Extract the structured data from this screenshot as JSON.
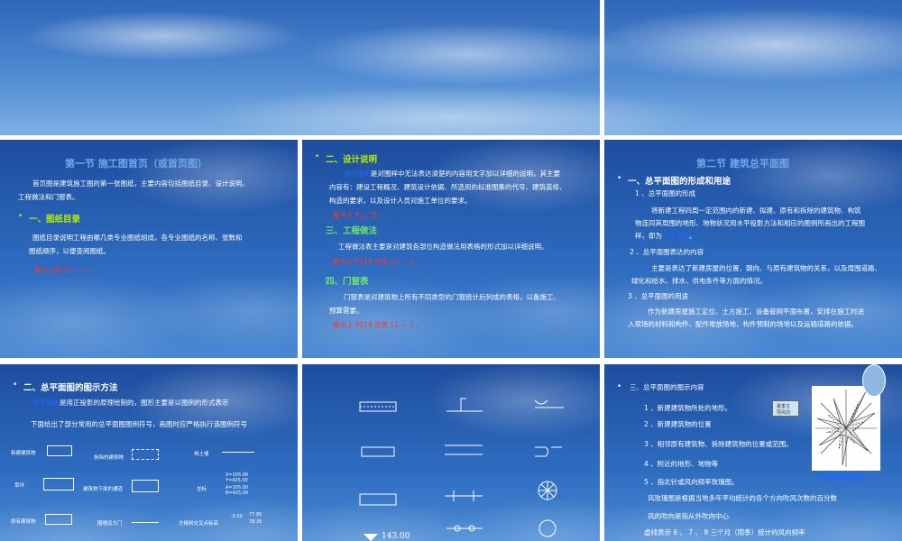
{
  "slide1": {
    "title": "第一节 施工图首页（或首页图）",
    "intro1": "首页图是建筑施工图的第一张图纸，主要内容包括图纸目录、设计说明、",
    "intro2": "工程做法和门窗表。",
    "bullet": "•",
    "heading": "一、图纸目录",
    "p1": "图纸目录说明工程由哪几类专业图纸组成，各专业图纸的名称、张数和",
    "p2": "图纸顺序，以便查阅图纸。",
    "ref": "看书上表 11 － 1 。"
  },
  "slide2": {
    "bullet": "•",
    "heading1": "二、设计说明",
    "hl": "设计说明",
    "p1": "是对图样中无法表达清楚的内容用文字加以详细的说明，其主要",
    "p2": "内容有：建设工程概况、建筑设计依据、所选用的标准图集的代号、建筑装修、",
    "p3": "构造的要求，以及设计人员对施工单位的要求。",
    "ref1": "看书上 P",
    "ref1sub": "217",
    "ref1end": " 页。",
    "heading2": "三、工程做法",
    "p4": "工程做法表主要是对建筑各部位构造做法用表格的形式加以详细说明。",
    "ref2": "看书上 P219 页表 11 － 2 。",
    "heading3": "四、门窗表",
    "p5": "门窗表是对建筑物上所有不同类型的门窗统计后列成的表格，以备施工、",
    "p6": "预算需要。",
    "ref3": "看书上 P219 页表 11 － 1 。"
  },
  "slide3": {
    "title": "第二节  建筑总平面图",
    "bullet": "•",
    "heading": "一、总平面图的形成和用途",
    "s1": "1 、总平面图的形成",
    "p1": "将新建工程四周一定范围内的新建、拟建、原有和拆除的建筑物、构筑",
    "p2": "物连同其周围的地形、地物状况用水平投影方法和相应的图例所画出的工程图",
    "p3a": "样，即为",
    "p3hl": "总平面图",
    "p3b": "。",
    "s2": "2 、总平面图表达的内容",
    "p4": "主要是表达了新建房屋的位置、朝向、与原有建筑物的关系，以及周围道路、",
    "p5": "绿化和给水、排水、供电条件等方面的情况。",
    "s3": "3 、总平面图的用途",
    "p6": "作为新建房屋施工定位、土方施工、设备管网平面布置，安排在施工时进",
    "p7": "入现场的材料和构件、配件堆放场地、构件预制的场地以及运输道路的依据。"
  },
  "slide4": {
    "bullet": "•",
    "heading": "二、总平面图的图示方法",
    "p1a": "总平面图",
    "p1b": "是用正投影的原理绘制的，图形主要是以图例的形式表示",
    "p2": "下面给出了部分常用的总平面图图例符号，画图时应严格执行该图例符号",
    "labels": [
      "新建建筑物",
      "拆除的建筑物",
      "挡土墙",
      "草坪",
      "建筑物下面的通道",
      "坐标",
      "原有建筑物",
      "围墙及大门",
      "方格网交叉点标高"
    ],
    "coord1": "X=105.00",
    "coord2": "Y=425.00",
    "coord3": "A=105.00",
    "coord4": "B=425.00",
    "elev1": "-0.50",
    "elev2": "77.85",
    "elev3": "78.35"
  },
  "slide5": {
    "elevation": "143.00"
  },
  "slide6": {
    "bullet": "•",
    "heading": "三、总平面图的图示内容",
    "i1": "1 、新建建筑物所处的地形。",
    "i2": "2 、新建建筑物的位置",
    "i3": "3 、相邻原有建筑物、拆除建筑物的位置或范围。",
    "i4": "4 、附近的地形、地物等",
    "i5": "5 、指北针或风向频率玫瑰图。",
    "p1": "风玫瑰图是根据当地多年平均统计的各个方向吹风次数的百分数",
    "p2": "风的吹向是指从外吹向中心",
    "p3": "虚线表示 6 、 7 、 8 三个月（雨季）统计的风向频率",
    "rose_label": "风向频率玫瑰图",
    "callout1": "夏季主",
    "callout2": "导风向"
  },
  "colors": {
    "accent_green": "#b4f000",
    "ref_red": "#ff3333",
    "title_blue": "#6fa8e8"
  }
}
